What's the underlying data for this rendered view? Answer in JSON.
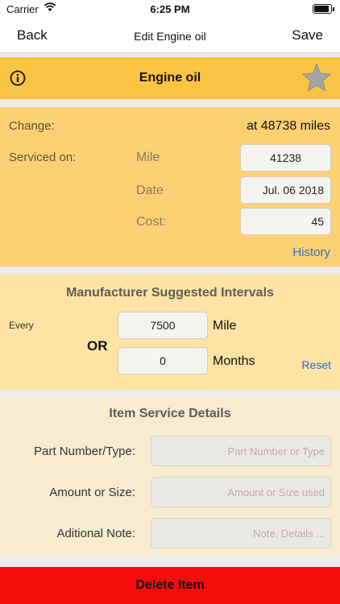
{
  "status": {
    "carrier": "Carrier",
    "time": "6:25 PM"
  },
  "nav": {
    "back": "Back",
    "title": "Edit Engine oil",
    "save": "Save"
  },
  "item": {
    "name": "Engine oil"
  },
  "service": {
    "change_label": "Change:",
    "change_value": "at 48738 miles",
    "serviced_label": "Serviced on:",
    "mile_label": "Mile",
    "mile_value": "41238",
    "date_label": "Date",
    "date_value": "Jul. 06 2018",
    "cost_label": "Cost:",
    "cost_value": "45",
    "history_link": "History"
  },
  "intervals": {
    "heading": "Manufacturer Suggested Intervals",
    "every_label": "Every",
    "or_label": "OR",
    "mile_value": "7500",
    "mile_unit": "Mile",
    "months_value": "0",
    "months_unit": "Months",
    "reset_link": "Reset"
  },
  "details": {
    "heading": "Item Service Details",
    "part_label": "Part Number/Type:",
    "part_placeholder": "Part Number or Type",
    "amount_label": "Amount or Size:",
    "amount_placeholder": "Amount or Size used",
    "note_label": "Aditional Note:",
    "note_placeholder": "Note, Details ..."
  },
  "actions": {
    "delete": "Delete Item"
  },
  "colors": {
    "header": "#fcc443",
    "delete": "#f40d0d",
    "link": "#2a6fc4"
  }
}
